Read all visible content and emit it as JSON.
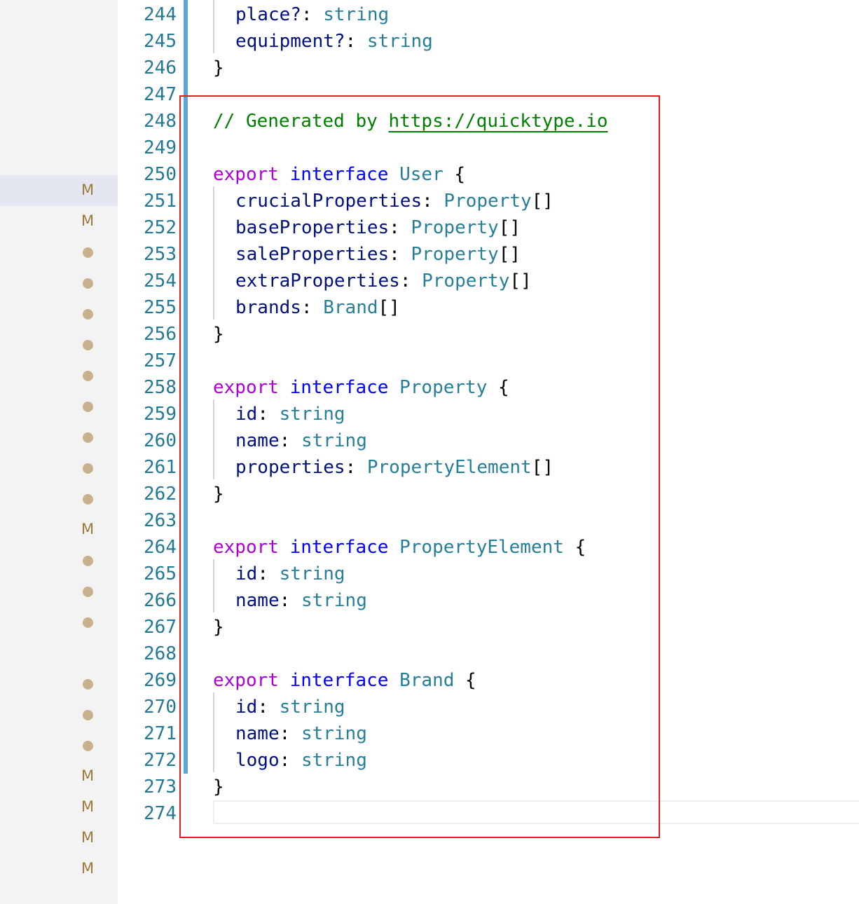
{
  "scm_markers": [
    {
      "kind": "M",
      "active": true
    },
    {
      "kind": "M",
      "active": false
    },
    {
      "kind": "dot"
    },
    {
      "kind": "dot"
    },
    {
      "kind": "dot"
    },
    {
      "kind": "dot"
    },
    {
      "kind": "dot"
    },
    {
      "kind": "dot"
    },
    {
      "kind": "dot"
    },
    {
      "kind": "dot"
    },
    {
      "kind": "dot"
    },
    {
      "kind": "M",
      "active": false
    },
    {
      "kind": "dot"
    },
    {
      "kind": "dot"
    },
    {
      "kind": "dot"
    },
    {
      "kind": "none"
    },
    {
      "kind": "dot"
    },
    {
      "kind": "dot"
    },
    {
      "kind": "dot"
    },
    {
      "kind": "M",
      "active": false
    },
    {
      "kind": "M",
      "active": false
    },
    {
      "kind": "M",
      "active": false
    },
    {
      "kind": "M",
      "active": false
    }
  ],
  "lines": [
    {
      "n": "244",
      "indent": 1,
      "tokens": [
        [
          "pr",
          "place?"
        ],
        [
          "pn",
          ": "
        ],
        [
          "ty",
          "string"
        ]
      ]
    },
    {
      "n": "245",
      "indent": 1,
      "tokens": [
        [
          "pr",
          "equipment?"
        ],
        [
          "pn",
          ": "
        ],
        [
          "ty",
          "string"
        ]
      ]
    },
    {
      "n": "246",
      "indent": 0,
      "tokens": [
        [
          "pn",
          "}"
        ]
      ]
    },
    {
      "n": "247",
      "indent": 0,
      "tokens": []
    },
    {
      "n": "248",
      "indent": 0,
      "tokens": [
        [
          "cm",
          "// Generated by "
        ],
        [
          "lk",
          "https://quicktype.io"
        ]
      ]
    },
    {
      "n": "249",
      "indent": 0,
      "tokens": []
    },
    {
      "n": "250",
      "indent": 0,
      "tokens": [
        [
          "kw",
          "export"
        ],
        [
          "pn",
          " "
        ],
        [
          "kw2",
          "interface"
        ],
        [
          "pn",
          " "
        ],
        [
          "ty",
          "User"
        ],
        [
          "pn",
          " {"
        ]
      ]
    },
    {
      "n": "251",
      "indent": 1,
      "tokens": [
        [
          "pr",
          "crucialProperties"
        ],
        [
          "pn",
          ": "
        ],
        [
          "ty",
          "Property"
        ],
        [
          "pn",
          "[]"
        ]
      ]
    },
    {
      "n": "252",
      "indent": 1,
      "tokens": [
        [
          "pr",
          "baseProperties"
        ],
        [
          "pn",
          ": "
        ],
        [
          "ty",
          "Property"
        ],
        [
          "pn",
          "[]"
        ]
      ]
    },
    {
      "n": "253",
      "indent": 1,
      "tokens": [
        [
          "pr",
          "saleProperties"
        ],
        [
          "pn",
          ": "
        ],
        [
          "ty",
          "Property"
        ],
        [
          "pn",
          "[]"
        ]
      ]
    },
    {
      "n": "254",
      "indent": 1,
      "tokens": [
        [
          "pr",
          "extraProperties"
        ],
        [
          "pn",
          ": "
        ],
        [
          "ty",
          "Property"
        ],
        [
          "pn",
          "[]"
        ]
      ]
    },
    {
      "n": "255",
      "indent": 1,
      "tokens": [
        [
          "pr",
          "brands"
        ],
        [
          "pn",
          ": "
        ],
        [
          "ty",
          "Brand"
        ],
        [
          "pn",
          "[]"
        ]
      ]
    },
    {
      "n": "256",
      "indent": 0,
      "tokens": [
        [
          "pn",
          "}"
        ]
      ]
    },
    {
      "n": "257",
      "indent": 0,
      "tokens": []
    },
    {
      "n": "258",
      "indent": 0,
      "tokens": [
        [
          "kw",
          "export"
        ],
        [
          "pn",
          " "
        ],
        [
          "kw2",
          "interface"
        ],
        [
          "pn",
          " "
        ],
        [
          "ty",
          "Property"
        ],
        [
          "pn",
          " {"
        ]
      ]
    },
    {
      "n": "259",
      "indent": 1,
      "tokens": [
        [
          "pr",
          "id"
        ],
        [
          "pn",
          ": "
        ],
        [
          "ty",
          "string"
        ]
      ]
    },
    {
      "n": "260",
      "indent": 1,
      "tokens": [
        [
          "pr",
          "name"
        ],
        [
          "pn",
          ": "
        ],
        [
          "ty",
          "string"
        ]
      ]
    },
    {
      "n": "261",
      "indent": 1,
      "tokens": [
        [
          "pr",
          "properties"
        ],
        [
          "pn",
          ": "
        ],
        [
          "ty",
          "PropertyElement"
        ],
        [
          "pn",
          "[]"
        ]
      ]
    },
    {
      "n": "262",
      "indent": 0,
      "tokens": [
        [
          "pn",
          "}"
        ]
      ]
    },
    {
      "n": "263",
      "indent": 0,
      "tokens": []
    },
    {
      "n": "264",
      "indent": 0,
      "tokens": [
        [
          "kw",
          "export"
        ],
        [
          "pn",
          " "
        ],
        [
          "kw2",
          "interface"
        ],
        [
          "pn",
          " "
        ],
        [
          "ty",
          "PropertyElement"
        ],
        [
          "pn",
          " {"
        ]
      ]
    },
    {
      "n": "265",
      "indent": 1,
      "tokens": [
        [
          "pr",
          "id"
        ],
        [
          "pn",
          ": "
        ],
        [
          "ty",
          "string"
        ]
      ]
    },
    {
      "n": "266",
      "indent": 1,
      "tokens": [
        [
          "pr",
          "name"
        ],
        [
          "pn",
          ": "
        ],
        [
          "ty",
          "string"
        ]
      ]
    },
    {
      "n": "267",
      "indent": 0,
      "tokens": [
        [
          "pn",
          "}"
        ]
      ]
    },
    {
      "n": "268",
      "indent": 0,
      "tokens": []
    },
    {
      "n": "269",
      "indent": 0,
      "tokens": [
        [
          "kw",
          "export"
        ],
        [
          "pn",
          " "
        ],
        [
          "kw2",
          "interface"
        ],
        [
          "pn",
          " "
        ],
        [
          "ty",
          "Brand"
        ],
        [
          "pn",
          " {"
        ]
      ]
    },
    {
      "n": "270",
      "indent": 1,
      "tokens": [
        [
          "pr",
          "id"
        ],
        [
          "pn",
          ": "
        ],
        [
          "ty",
          "string"
        ]
      ]
    },
    {
      "n": "271",
      "indent": 1,
      "tokens": [
        [
          "pr",
          "name"
        ],
        [
          "pn",
          ": "
        ],
        [
          "ty",
          "string"
        ]
      ]
    },
    {
      "n": "272",
      "indent": 1,
      "tokens": [
        [
          "pr",
          "logo"
        ],
        [
          "pn",
          ": "
        ],
        [
          "ty",
          "string"
        ]
      ]
    },
    {
      "n": "273",
      "indent": 0,
      "tokens": [
        [
          "pn",
          "}"
        ]
      ]
    },
    {
      "n": "274",
      "indent": 0,
      "tokens": []
    }
  ],
  "colors": {
    "keyword_export": "#af00db",
    "keyword_interface": "#0000ff",
    "type": "#267f99",
    "property": "#001080",
    "comment": "#008000",
    "line_number": "#237893",
    "scm_modified": "#9c7a3c",
    "change_bar": "#5da5da",
    "highlight_box": "#e02020"
  }
}
